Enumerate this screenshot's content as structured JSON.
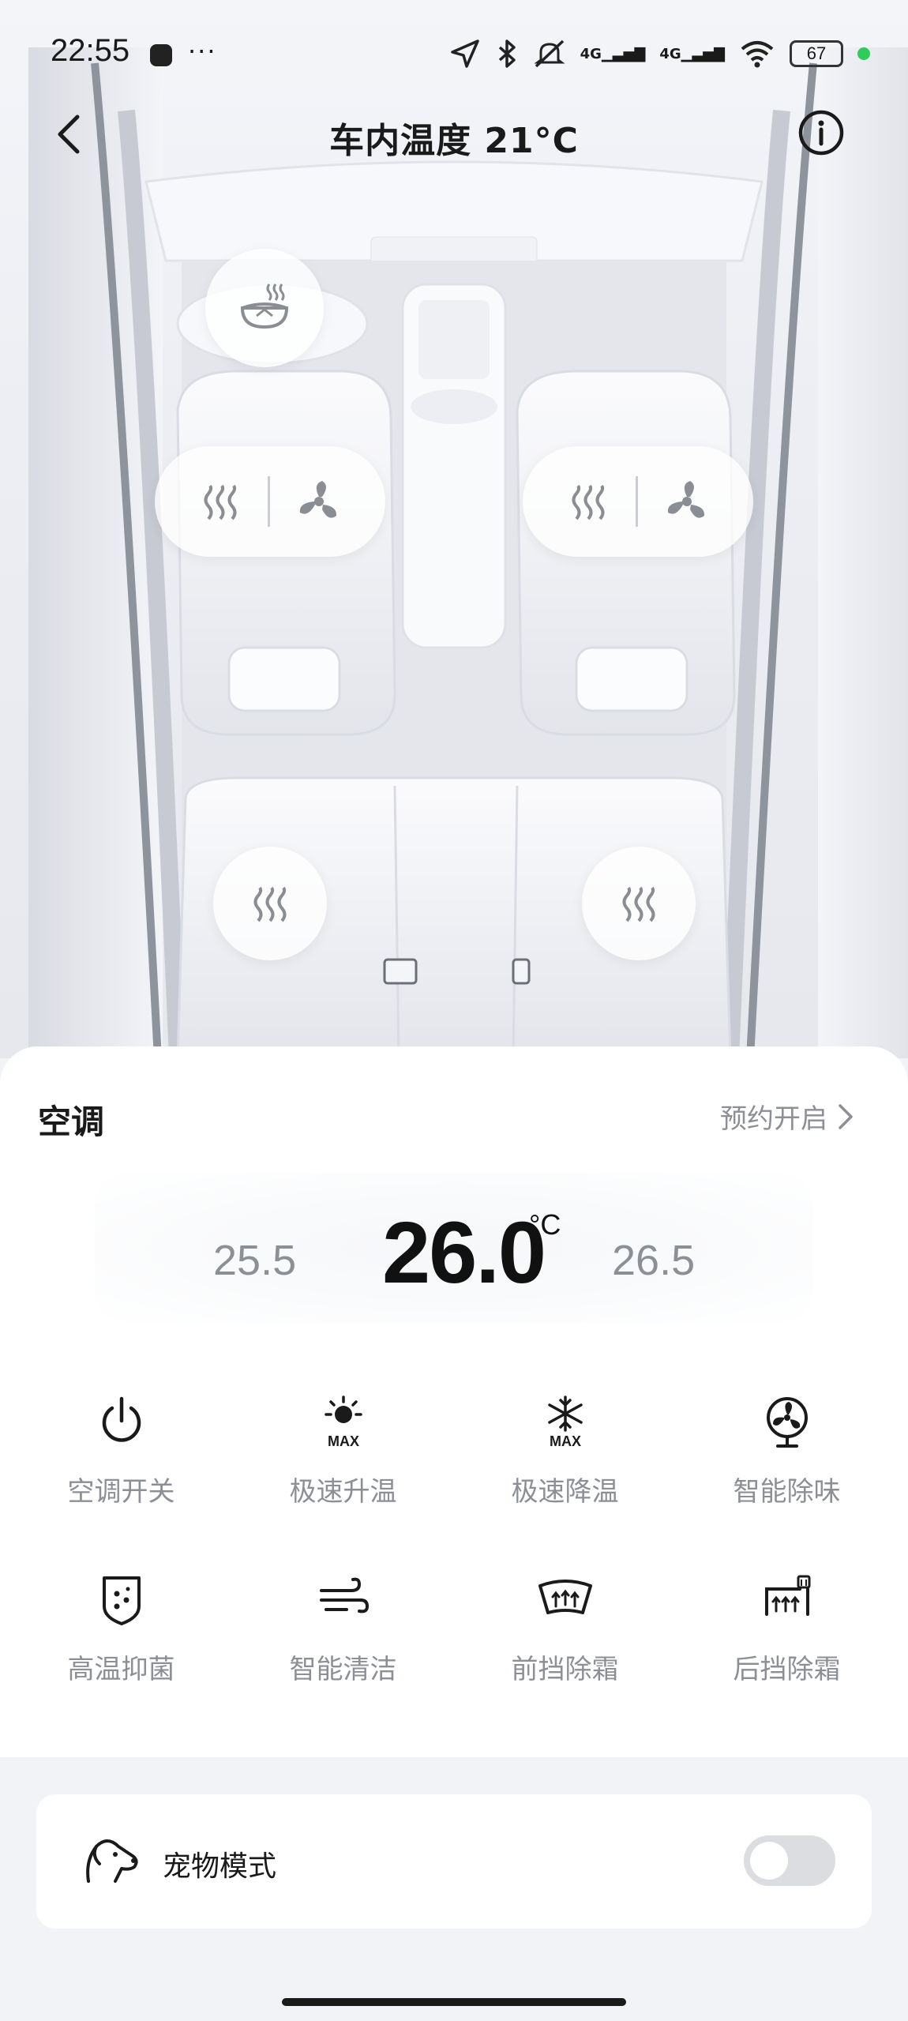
{
  "status_bar": {
    "time": "22:55",
    "dots": "···",
    "net1": "4G",
    "net2": "4G",
    "battery": "67"
  },
  "nav": {
    "title": "车内温度 21°C"
  },
  "ac": {
    "title": "空调",
    "schedule_label": "预约开启",
    "temp_prev": "25.5",
    "temp_current": "26.0",
    "temp_unit": "°C",
    "temp_next": "26.5"
  },
  "controls": [
    {
      "label": "空调开关",
      "icon": "power-icon"
    },
    {
      "label": "极速升温",
      "icon": "sun-max-icon"
    },
    {
      "label": "极速降温",
      "icon": "snowflake-max-icon"
    },
    {
      "label": "智能除味",
      "icon": "fan-icon"
    },
    {
      "label": "高温抑菌",
      "icon": "shield-icon"
    },
    {
      "label": "智能清洁",
      "icon": "wind-icon"
    },
    {
      "label": "前挡除霜",
      "icon": "front-defrost-icon"
    },
    {
      "label": "后挡除霜",
      "icon": "rear-defrost-icon"
    }
  ],
  "pet_mode": {
    "label": "宠物模式",
    "enabled": false
  },
  "colors": {
    "accent": "#1a1a1a",
    "muted": "#8c8f96",
    "toggle_off": "#dcdde1",
    "online": "#2ecc5a"
  }
}
